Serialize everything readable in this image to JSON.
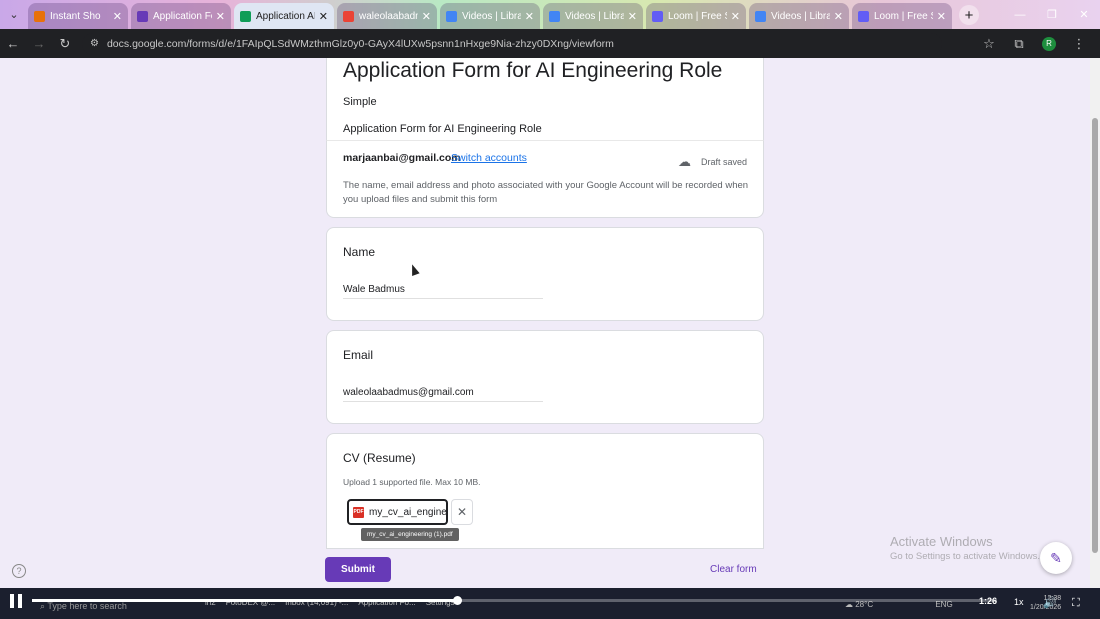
{
  "browser": {
    "tabs": [
      {
        "title": "Instant Sho",
        "fav_color": "#e8710a",
        "active": false
      },
      {
        "title": "Application Fo",
        "fav_color": "#673ab7",
        "active": false
      },
      {
        "title": "Application AI",
        "fav_color": "#0f9d58",
        "active": true
      },
      {
        "title": "waleolaabadm",
        "fav_color": "#ea4335",
        "active": false
      },
      {
        "title": "Videos | Libra",
        "fav_color": "#4285f4",
        "active": false
      },
      {
        "title": "Videos | Libra",
        "fav_color": "#4285f4",
        "active": false
      },
      {
        "title": "Loom | Free Sc",
        "fav_color": "#625df5",
        "active": false
      },
      {
        "title": "Videos | Libra",
        "fav_color": "#4285f4",
        "active": false
      },
      {
        "title": "Loom | Free Sc",
        "fav_color": "#625df5",
        "active": false
      }
    ],
    "url": "docs.google.com/forms/d/e/1FAIpQLSdWMzthmGlz0y0-GAyX4lUXw5psnn1nHxge9Nia-zhzy0DXng/viewform",
    "profile_initial": "R"
  },
  "form": {
    "title": "Application Form for AI Engineering Role",
    "subtitle": "Simple",
    "description": "Application Form for AI Engineering Role",
    "account_email": "marjaanbai@gmail.com",
    "switch_accounts": "Switch accounts",
    "draft_status": "Draft saved",
    "account_note": "The name, email address and photo associated with your Google Account will be recorded when you upload files and submit this form",
    "questions": [
      {
        "label": "Name",
        "value": "Wale Badmus"
      },
      {
        "label": "Email",
        "value": "waleolaabadmus@gmail.com"
      }
    ],
    "cv": {
      "label": "CV (Resume)",
      "help": "Upload 1 supported file. Max 10 MB.",
      "file_name": "my_cv_ai_engine...",
      "file_tooltip": "my_cv_ai_engineering (1).pdf",
      "file_type": "PDF"
    },
    "submit_label": "Submit",
    "clear_label": "Clear form"
  },
  "watermark": {
    "line1": "Activate Windows",
    "line2": "Go to Settings to activate Windows."
  },
  "taskbar": {
    "search_placeholder": "Type here to search",
    "apps": [
      "in2",
      "FotoDEX @...",
      "Inbox (14,091) -...",
      "Application Fo...",
      "Settings"
    ],
    "weather": "28°C",
    "lang": "ENG",
    "clock_time": "12:38",
    "clock_date": "1/20/2026"
  },
  "player": {
    "elapsed": "1:26",
    "speed": "1x",
    "progress": 0.44
  }
}
